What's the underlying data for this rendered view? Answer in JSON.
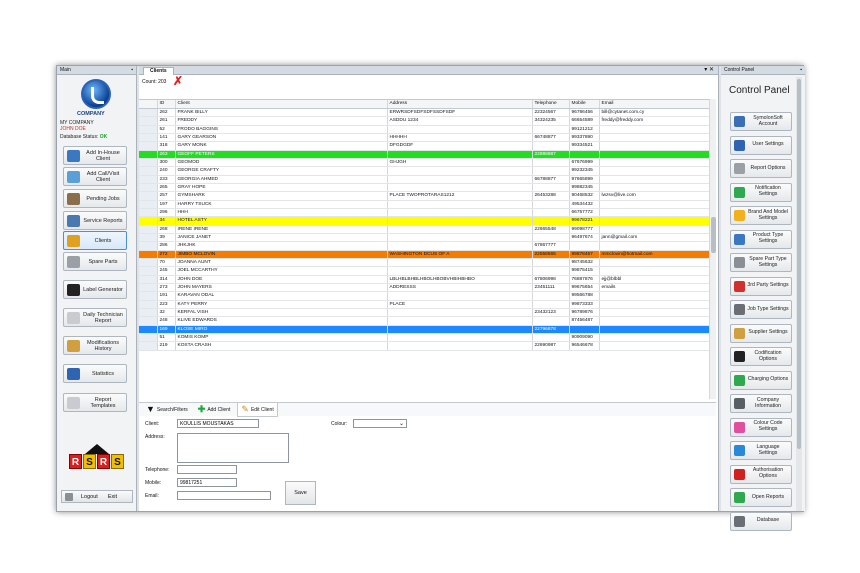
{
  "main_panel": {
    "title": "Main",
    "company": "COMPANY",
    "company_line": "MY COMPANY",
    "user": "JOHN DOE",
    "db_status_label": "Database Status:",
    "db_status_value": "OK",
    "nav": [
      {
        "label": "Add In-House Client",
        "icon": "client-add-icon",
        "color": "#3a78c2"
      },
      {
        "label": "Add Call/Visit Client",
        "icon": "client-visit-icon",
        "color": "#5aa0d8"
      },
      {
        "label": "Pending Jobs",
        "icon": "pending-jobs-icon",
        "color": "#8a6d4a"
      },
      {
        "label": "Service Reports",
        "icon": "service-reports-icon",
        "color": "#4a78b0"
      },
      {
        "label": "Clients",
        "icon": "clients-icon",
        "color": "#e0a020"
      },
      {
        "label": "Spare Parts",
        "icon": "spare-parts-icon",
        "color": "#9aa0a6"
      },
      {
        "label": "Label Generator",
        "icon": "label-generator-icon",
        "color": "#222222"
      },
      {
        "label": "Daily Technician Report",
        "icon": "technician-report-icon",
        "color": "#c8ccd0"
      },
      {
        "label": "Modifications History",
        "icon": "modifications-icon",
        "color": "#d0a040"
      },
      {
        "label": "Statistics",
        "icon": "statistics-icon",
        "color": "#2f64b0"
      },
      {
        "label": "Report Templates",
        "icon": "report-templates-icon",
        "color": "#c8ccd0"
      }
    ],
    "brand_letters": [
      "R",
      "S",
      "R",
      "S"
    ],
    "logout_label": "Logout",
    "exit_label": "Exit"
  },
  "clients_panel": {
    "tab_label": "Clients",
    "count_text": "Count: 203",
    "columns": [
      "ID",
      "Client",
      "Address",
      "Telephone",
      "Mobile",
      "Email"
    ],
    "rows": [
      {
        "id": "262",
        "client": "FRANK BILLY",
        "address": "ERWRSDFSDFSDFSSDFSDF",
        "tel": "22324567",
        "mobile": "96786456",
        "email": "bill@cytanet.com.cy",
        "hl": ""
      },
      {
        "id": "261",
        "client": "FREDDY",
        "address": "ASDDU 1234",
        "tel": "34324235",
        "mobile": "66654589",
        "email": "freddy@freddy.com",
        "hl": ""
      },
      {
        "id": "52",
        "client": "FRODO BAGGINS",
        "address": "",
        "tel": "",
        "mobile": "99121212",
        "email": "",
        "hl": ""
      },
      {
        "id": "141",
        "client": "GARY GEARSON",
        "address": "HHHHH",
        "tel": "66748877",
        "mobile": "99337890",
        "email": "",
        "hl": ""
      },
      {
        "id": "318",
        "client": "GARY MONK",
        "address": "DFGDGDF",
        "tel": "",
        "mobile": "99334521",
        "email": "",
        "hl": ""
      },
      {
        "id": "263",
        "client": "GEOFF PETERS",
        "address": "",
        "tel": "22898887",
        "mobile": "",
        "email": "",
        "hl": "green"
      },
      {
        "id": "300",
        "client": "GEOMOD",
        "address": "GHJGH",
        "tel": "",
        "mobile": "67676999",
        "email": "",
        "hl": ""
      },
      {
        "id": "240",
        "client": "GEORGE CRAFTY",
        "address": "",
        "tel": "",
        "mobile": "99232345",
        "email": "",
        "hl": ""
      },
      {
        "id": "233",
        "client": "GEORGIA AHMED",
        "address": "",
        "tel": "66788877",
        "mobile": "97665899",
        "email": "",
        "hl": ""
      },
      {
        "id": "265",
        "client": "GRAY HOPE",
        "address": "",
        "tel": "",
        "mobile": "99882345",
        "email": "",
        "hl": ""
      },
      {
        "id": "257",
        "client": "GYMSHARK",
        "address": "PLACE TWOPROTARAS1212",
        "tel": "26453288",
        "mobile": "90468532",
        "email": "lwzsv@live.com",
        "hl": ""
      },
      {
        "id": "197",
        "client": "HARRY TSUCK",
        "address": "",
        "tel": "",
        "mobile": "49534432",
        "email": "",
        "hl": ""
      },
      {
        "id": "296",
        "client": "HHH",
        "address": "",
        "tel": "",
        "mobile": "66757772",
        "email": "",
        "hl": ""
      },
      {
        "id": "34",
        "client": "HOTEL ASTY",
        "address": "",
        "tel": "",
        "mobile": "99678221",
        "email": "",
        "hl": "yellow"
      },
      {
        "id": "268",
        "client": "IRENE IRENE",
        "address": "",
        "tel": "22665548",
        "mobile": "99098777",
        "email": "",
        "hl": ""
      },
      {
        "id": "39",
        "client": "JANICE JANET",
        "address": "",
        "tel": "",
        "mobile": "96497674",
        "email": "jann@gmail.com",
        "hl": ""
      },
      {
        "id": "286",
        "client": "JHKJHK",
        "address": "",
        "tel": "67867777",
        "mobile": "",
        "email": "",
        "hl": ""
      },
      {
        "id": "272",
        "client": "JIMBO MCLOVIN",
        "address": "WASHINGTON DCUS OF A",
        "tel": "22558565",
        "mobile": "99878457",
        "email": "mmclovin@hotmail.com",
        "hl": "orange"
      },
      {
        "id": "70",
        "client": "JOANNA AUNT",
        "address": "",
        "tel": "",
        "mobile": "98745632",
        "email": "",
        "hl": ""
      },
      {
        "id": "245",
        "client": "JOEL MCCARTHY",
        "address": "",
        "tel": "",
        "mobile": "99875415",
        "email": "",
        "hl": ""
      },
      {
        "id": "314",
        "client": "JOHN DOE",
        "address": "LBLHBLBHBLHBOLHBOBVHBIHBHBO",
        "tel": "67806998",
        "mobile": "76887876",
        "email": "ejj@blbbl",
        "hl": ""
      },
      {
        "id": "273",
        "client": "JOHN MAYERS",
        "address": "ADDRESSS",
        "tel": "23451111",
        "mobile": "99675654",
        "email": "emails",
        "hl": ""
      },
      {
        "id": "191",
        "client": "KARAVAN ODAL",
        "address": "",
        "tel": "",
        "mobile": "99566788",
        "email": "",
        "hl": ""
      },
      {
        "id": "223",
        "client": "KATY PERRY",
        "address": "PLACE",
        "tel": "",
        "mobile": "99873333",
        "email": "",
        "hl": ""
      },
      {
        "id": "32",
        "client": "KERFAL VISH",
        "address": "",
        "tel": "23432123",
        "mobile": "96789876",
        "email": "",
        "hl": ""
      },
      {
        "id": "248",
        "client": "KLIVE EDWARDS",
        "address": "",
        "tel": "",
        "mobile": "87456487",
        "email": "",
        "hl": ""
      },
      {
        "id": "169",
        "client": "KLOSE MIRO",
        "address": "",
        "tel": "22796878",
        "mobile": "",
        "email": "",
        "hl": "blue"
      },
      {
        "id": "51",
        "client": "KOMIS KOMP",
        "address": "",
        "tel": "",
        "mobile": "90909090",
        "email": "",
        "hl": ""
      },
      {
        "id": "219",
        "client": "KOSTA CRASH",
        "address": "",
        "tel": "22690987",
        "mobile": "96546678",
        "email": "",
        "hl": ""
      }
    ],
    "toolbar": {
      "search_label": "Search/Filters",
      "add_label": "Add Client",
      "edit_label": "Edit Client"
    },
    "form": {
      "client_label": "Client:",
      "client_value": "KOULLIS MOUSTAKAS",
      "address_label": "Address:",
      "colour_label": "Colour:",
      "telephone_label": "Telephone:",
      "mobile_label": "Mobile:",
      "mobile_value": "99817251",
      "email_label": "Email:",
      "save_label": "Save"
    }
  },
  "control_panel": {
    "title_bar": "Control Panel",
    "heading": "Control Panel",
    "buttons": [
      {
        "label": "SymolonSoft Account",
        "icon": "account-icon",
        "color": "#3a6fb5"
      },
      {
        "label": "User Settings",
        "icon": "user-settings-icon",
        "color": "#2f64b0"
      },
      {
        "label": "Report Options",
        "icon": "report-options-icon",
        "color": "#9aa0a6"
      },
      {
        "label": "Notification Settings",
        "icon": "notification-icon",
        "color": "#2fa84f"
      },
      {
        "label": "Brand And Model Settings",
        "icon": "brand-model-icon",
        "color": "#f0b020"
      },
      {
        "label": "Product Type Settings",
        "icon": "product-type-icon",
        "color": "#3a78c2"
      },
      {
        "label": "Spare Part Type Settings",
        "icon": "spare-part-type-icon",
        "color": "#8a8f95"
      },
      {
        "label": "3rd Party Settings",
        "icon": "third-party-icon",
        "color": "#d03030"
      },
      {
        "label": "Job Type Settings",
        "icon": "job-type-icon",
        "color": "#6a6f75"
      },
      {
        "label": "Supplier Settings",
        "icon": "supplier-icon",
        "color": "#d0a040"
      },
      {
        "label": "Codification Options",
        "icon": "qr-code-icon",
        "color": "#222222"
      },
      {
        "label": "Charging Options",
        "icon": "charging-icon",
        "color": "#2fa84f"
      },
      {
        "label": "Company Information",
        "icon": "company-info-icon",
        "color": "#5a5f65"
      },
      {
        "label": "Colour Code Settings",
        "icon": "colour-wheel-icon",
        "color": "#e04fa0"
      },
      {
        "label": "Language Settings",
        "icon": "globe-icon",
        "color": "#2a88d8"
      },
      {
        "label": "Authorisation Options",
        "icon": "no-entry-icon",
        "color": "#d02020"
      },
      {
        "label": "Open Reports",
        "icon": "open-reports-icon",
        "color": "#2fa84f"
      },
      {
        "label": "Database",
        "icon": "database-icon",
        "color": "#6a6f75"
      }
    ]
  }
}
